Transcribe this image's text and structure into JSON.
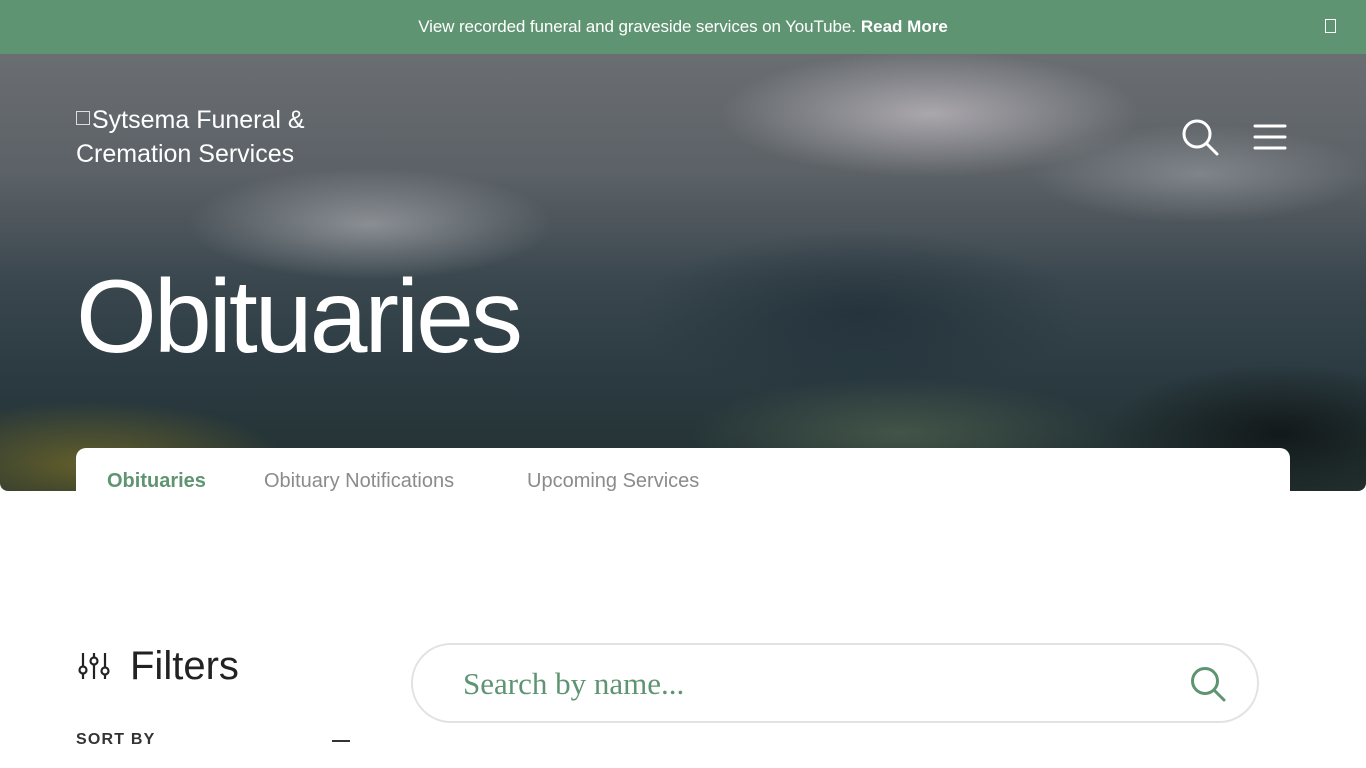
{
  "announcement": {
    "message": "View recorded funeral and graveside services on YouTube.",
    "link_label": "Read More"
  },
  "header": {
    "logo_text": "Sytsema Funeral & Cremation Services"
  },
  "hero": {
    "title": "Obituaries"
  },
  "tabs": [
    {
      "label": "Obituaries",
      "active": true
    },
    {
      "label": "Obituary Notifications",
      "active": false
    },
    {
      "label": "Upcoming Services",
      "active": false
    }
  ],
  "filters": {
    "title": "Filters",
    "sort_by_label": "SORT BY"
  },
  "search": {
    "placeholder": "Search by name..."
  },
  "colors": {
    "accent": "#5f9473",
    "text_dark": "#222222",
    "tab_inactive": "#8b8b8b"
  },
  "icons": [
    "close-icon",
    "search-icon",
    "menu-icon",
    "filter-sliders-icon",
    "minus-icon"
  ]
}
